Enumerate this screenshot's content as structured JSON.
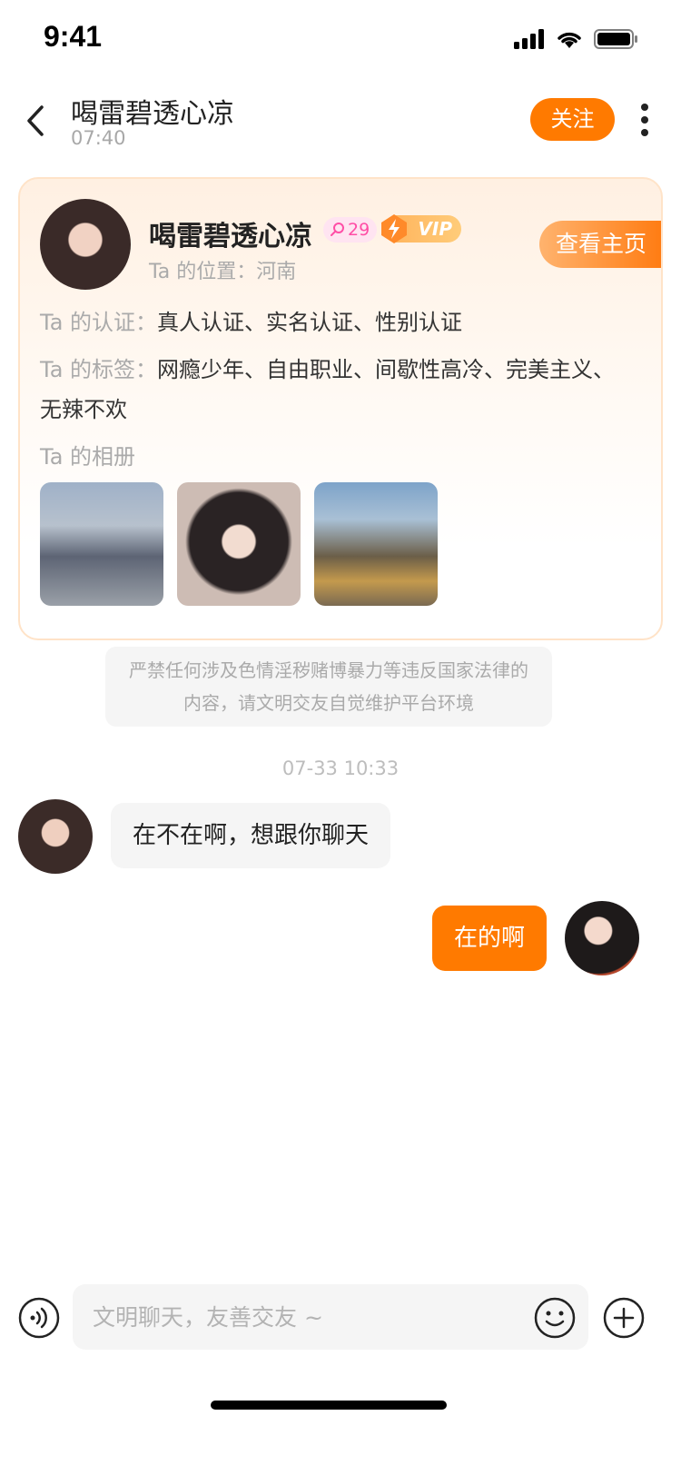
{
  "status_bar": {
    "time": "9:41"
  },
  "header": {
    "title": "喝雷碧透心凉",
    "subtitle": "07:40",
    "follow_label": "关注"
  },
  "profile": {
    "name": "喝雷碧透心凉",
    "age": "29",
    "vip_label": "VIP",
    "location_label": "Ta 的位置：",
    "location_value": "河南",
    "view_home_label": "查看主页",
    "cert_label": "Ta 的认证：",
    "cert_value": "真人认证、实名认证、性别认证",
    "tags_label": "Ta 的标签：",
    "tags_value": "网瘾少年、自由职业、间歇性高冷、完美主义、无辣不欢",
    "album_label": "Ta 的相册"
  },
  "notice": "严禁任何涉及色情淫秽赌博暴力等违反国家法律的内容，请文明交友自觉维护平台环境",
  "timestamp": "07-33 10:33",
  "messages": [
    {
      "from": "other",
      "text": "在不在啊，想跟你聊天"
    },
    {
      "from": "me",
      "text": "在的啊"
    }
  ],
  "input": {
    "placeholder": "文明聊天，友善交友 ~"
  },
  "colors": {
    "accent": "#ff7a00",
    "vip": "#ffb25a",
    "age_badge": "#ff4da6"
  }
}
